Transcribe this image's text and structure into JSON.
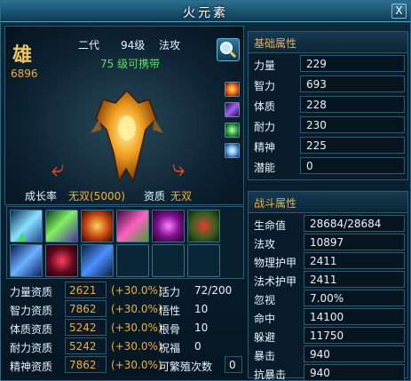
{
  "window": {
    "title": "火元素",
    "close_label": "X"
  },
  "pet": {
    "gender": "雄",
    "power": "6896",
    "generation": "二代",
    "level": "94级",
    "type": "法攻",
    "carry_level": "75",
    "carry_text": "级可携带",
    "growth_label": "成长率",
    "growth_value": "无双(5000)",
    "quality_label": "资质",
    "quality_value": "无双"
  },
  "buff_icons": [
    "fire-buff-icon",
    "lightning-buff-icon",
    "wind-buff-icon",
    "star-buff-icon"
  ],
  "skills": [
    {
      "name": "ice-slash-skill-icon"
    },
    {
      "name": "nature-slash-skill-icon"
    },
    {
      "name": "fire-beast-skill-icon"
    },
    {
      "name": "poison-claw-skill-icon"
    },
    {
      "name": "dark-bolt-skill-icon"
    },
    {
      "name": "horned-beast-skill-icon"
    },
    {
      "name": "lightning-storm-skill-icon"
    },
    {
      "name": "red-claw-skill-icon"
    },
    {
      "name": "tornado-skill-icon"
    }
  ],
  "aptitudes": [
    {
      "label": "力量资质",
      "value": "2621",
      "bonus": "(+30.0%)",
      "name": "活力",
      "nval": "72/200"
    },
    {
      "label": "智力资质",
      "value": "7862",
      "bonus": "(+30.0%)",
      "name": "悟性",
      "nval": "10"
    },
    {
      "label": "体质资质",
      "value": "5242",
      "bonus": "(+30.0%)",
      "name": "根骨",
      "nval": "10"
    },
    {
      "label": "耐力资质",
      "value": "5242",
      "bonus": "(+30.0%)",
      "name": "祝福",
      "nval": "0"
    },
    {
      "label": "精神资质",
      "value": "7862",
      "bonus": "(+30.0%)",
      "name": "可繁殖次数",
      "nval": "0"
    }
  ],
  "basic": {
    "title": "基础属性",
    "rows": [
      {
        "label": "力量",
        "value": "229"
      },
      {
        "label": "智力",
        "value": "693"
      },
      {
        "label": "体质",
        "value": "228"
      },
      {
        "label": "耐力",
        "value": "230"
      },
      {
        "label": "精神",
        "value": "225"
      },
      {
        "label": "潜能",
        "value": "0"
      }
    ]
  },
  "combat": {
    "title": "战斗属性",
    "rows": [
      {
        "label": "生命值",
        "value": "28684/28684"
      },
      {
        "label": "法攻",
        "value": "10897"
      },
      {
        "label": "物理护甲",
        "value": "2411"
      },
      {
        "label": "法术护甲",
        "value": "2411"
      },
      {
        "label": "忽视",
        "value": "7.00%"
      },
      {
        "label": "命中",
        "value": "14100"
      },
      {
        "label": "躲避",
        "value": "11750"
      },
      {
        "label": "暴击",
        "value": "940"
      },
      {
        "label": "抗暴击",
        "value": "940"
      }
    ]
  },
  "colors": {
    "accent": "#f0b040",
    "green": "#58e060",
    "frame": "#2c5a75"
  }
}
